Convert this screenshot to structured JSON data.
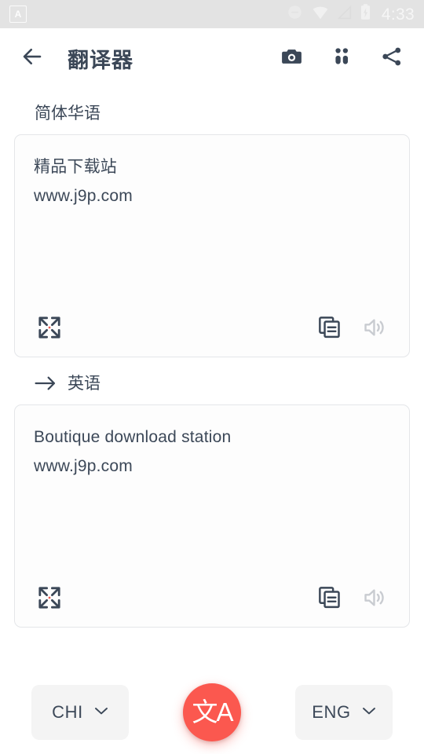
{
  "status_bar": {
    "notification_icon": "app-notification-icon",
    "notification_letter": "A",
    "icons": [
      "do-not-disturb-icon",
      "wifi-icon",
      "cellular-signal-icon",
      "battery-charging-icon"
    ],
    "time": "4:33",
    "background_color": "#e3e3e3"
  },
  "app_bar": {
    "back_icon": "back-arrow-icon",
    "title": "翻译器",
    "actions": [
      {
        "icon": "camera-icon"
      },
      {
        "icon": "apps-grid-icon"
      },
      {
        "icon": "share-icon"
      }
    ]
  },
  "source": {
    "language_label": "简体华语",
    "lines": [
      "精品下载站",
      "www.j9p.com"
    ],
    "actions": {
      "expand_icon": "fullscreen-expand-icon",
      "copy_icon": "copy-icon",
      "speak_icon": "speaker-icon"
    }
  },
  "target": {
    "arrow_glyph": "arrow-right-icon",
    "language_label": "英语",
    "lines": [
      "Boutique download station",
      "www.j9p.com"
    ],
    "actions": {
      "expand_icon": "fullscreen-expand-icon",
      "copy_icon": "copy-icon",
      "speak_icon": "speaker-icon"
    }
  },
  "bottom_bar": {
    "source_chip": {
      "label": "CHI",
      "chevron_icon": "chevron-down-icon"
    },
    "target_chip": {
      "label": "ENG",
      "chevron_icon": "chevron-down-icon"
    },
    "fab": {
      "glyph": "文A",
      "icon": "translate-icon",
      "color": "#fb584f"
    }
  },
  "colors": {
    "text": "#3c4858",
    "accent": "#fb584f",
    "card_border": "#e4e6e9",
    "chip_bg": "#f4f4f4",
    "disabled_icon": "#c9ccd1"
  }
}
